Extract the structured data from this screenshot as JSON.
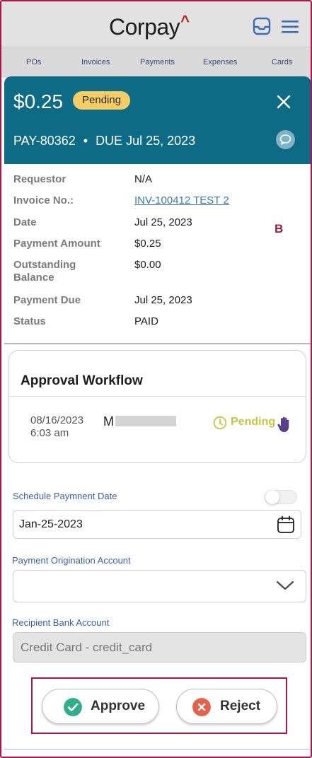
{
  "app": {
    "logo_text": "Corpay",
    "logo_mark": "^"
  },
  "nav": {
    "items": [
      {
        "label": "POs"
      },
      {
        "label": "Invoices"
      },
      {
        "label": "Payments"
      },
      {
        "label": "Expenses"
      },
      {
        "label": "Cards"
      }
    ]
  },
  "payment": {
    "amount": "$0.25",
    "status": "Pending",
    "id": "PAY-80362",
    "separator": "•",
    "due_text": "DUE Jul 25, 2023"
  },
  "details": [
    {
      "label": "Requestor",
      "value": "N/A"
    },
    {
      "label": "Invoice No.:",
      "value": "INV-100412 TEST 2"
    },
    {
      "label": "Date",
      "value": "Jul 25, 2023"
    },
    {
      "label": "Payment Amount",
      "value": "$0.25"
    },
    {
      "label": "Outstanding Balance",
      "value": "$0.00"
    },
    {
      "label": "Payment Due",
      "value": "Jul 25, 2023"
    },
    {
      "label": "Status",
      "value": "PAID"
    }
  ],
  "annotation_marker": "B",
  "workflow": {
    "title": "Approval Workflow",
    "entry": {
      "date": "08/16/2023",
      "time": "6:03 am",
      "name_initial": "M",
      "status": "Pending"
    }
  },
  "form": {
    "schedule_label": "Schedule Paymnent Date",
    "schedule_value": "Jan-25-2023",
    "origination_label": "Payment Origination Account",
    "origination_value": "",
    "recipient_label": "Recipient Bank Account",
    "recipient_value": "Credit Card - credit_card"
  },
  "actions": {
    "approve": "Approve",
    "reject": "Reject"
  },
  "colors": {
    "header_teal": "#0e6b85",
    "pending_pill": "#f6cd62",
    "approve_green": "#2fb08a",
    "reject_orange": "#e4614a",
    "link_blue": "#3a78b4",
    "highlight_border": "#b0154a"
  }
}
